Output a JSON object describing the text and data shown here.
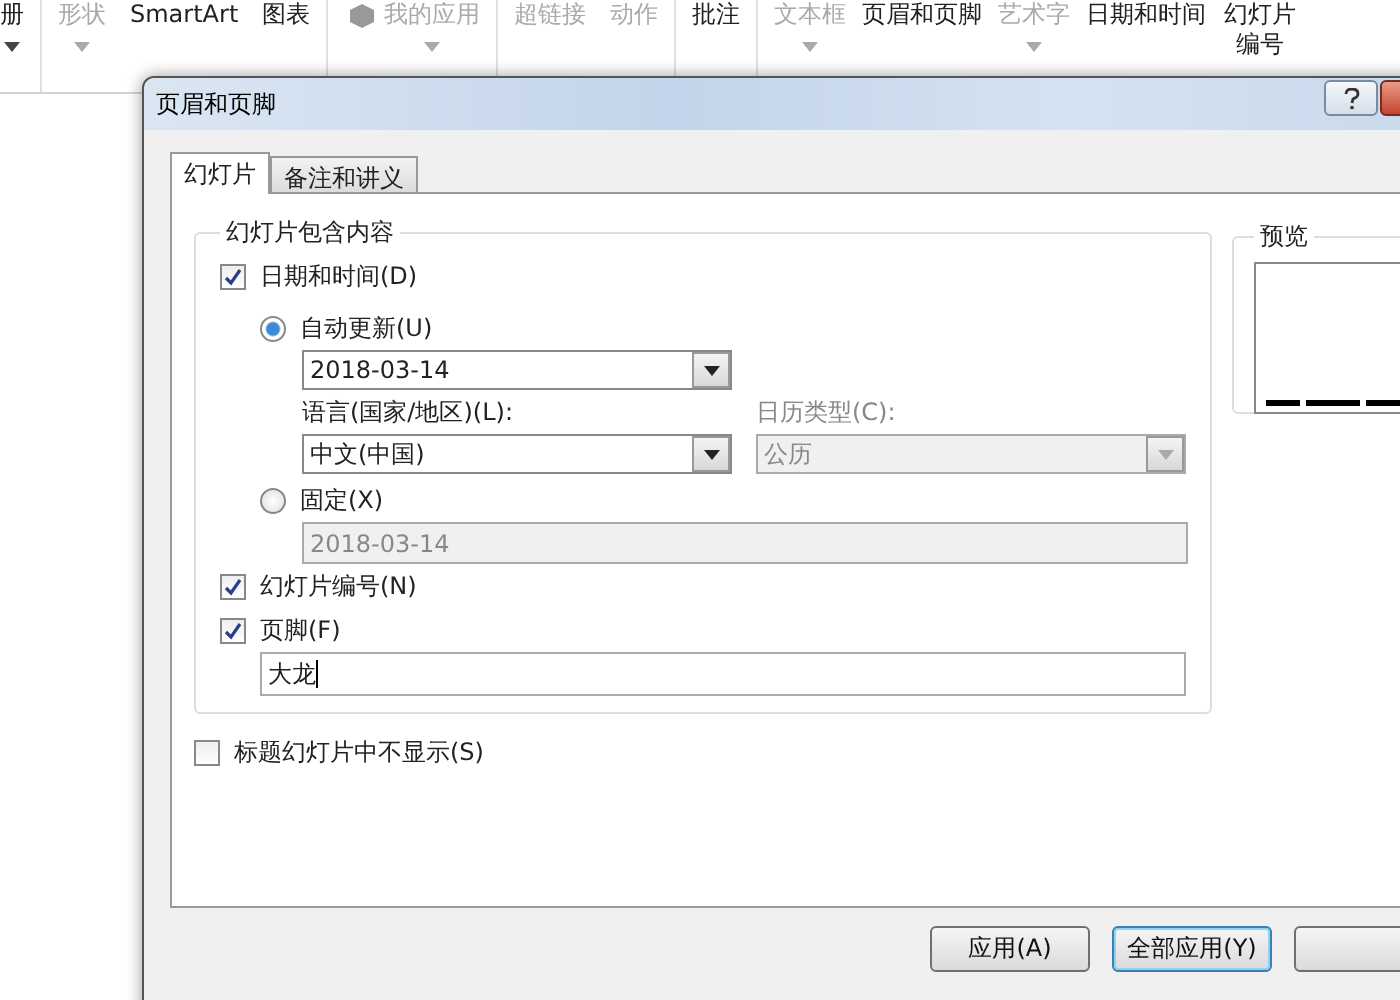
{
  "ribbon": {
    "groups": [
      {
        "items": [
          {
            "label": "册",
            "disabled": false,
            "dropdown": true
          }
        ]
      },
      {
        "items": [
          {
            "label": "形状",
            "disabled": true,
            "dropdown": true
          },
          {
            "label": "SmartArt",
            "disabled": false,
            "dropdown": false
          },
          {
            "label": "图表",
            "disabled": false,
            "dropdown": false
          }
        ]
      },
      {
        "items": [
          {
            "label": "我的应用",
            "disabled": true,
            "dropdown": true,
            "icon": true
          }
        ]
      },
      {
        "items": [
          {
            "label": "超链接",
            "disabled": true,
            "dropdown": false
          },
          {
            "label": "动作",
            "disabled": true,
            "dropdown": false
          }
        ]
      },
      {
        "items": [
          {
            "label": "批注",
            "disabled": false,
            "dropdown": false
          }
        ]
      },
      {
        "items": [
          {
            "label": "文本框",
            "disabled": true,
            "dropdown": true
          },
          {
            "label": "页眉和页脚",
            "disabled": false,
            "dropdown": false
          },
          {
            "label": "艺术字",
            "disabled": true,
            "dropdown": true
          },
          {
            "label": "日期和时间",
            "disabled": false,
            "dropdown": false
          },
          {
            "label": "幻灯片编号",
            "disabled": false,
            "dropdown": false,
            "wrap": true
          }
        ]
      }
    ]
  },
  "dialog": {
    "title": "页眉和页脚",
    "tabs": [
      {
        "label": "幻灯片",
        "selected": true
      },
      {
        "label": "备注和讲义",
        "selected": false
      }
    ],
    "content_group": {
      "title": "幻灯片包含内容",
      "date_time": {
        "label": "日期和时间(D)",
        "checked": true
      },
      "auto_update": {
        "label": "自动更新(U)",
        "selected": true
      },
      "date_format": {
        "value": "2018-03-14"
      },
      "language": {
        "label": "语言(国家/地区)(L):",
        "value": "中文(中国)"
      },
      "calendar": {
        "label": "日历类型(C):",
        "value": "公历",
        "disabled": true
      },
      "fixed": {
        "label": "固定(X)",
        "selected": false
      },
      "fixed_date": {
        "value": "2018-03-14",
        "disabled": true
      },
      "slide_number": {
        "label": "幻灯片编号(N)",
        "checked": true
      },
      "footer": {
        "label": "页脚(F)",
        "checked": true
      },
      "footer_text": {
        "value": "大龙"
      }
    },
    "hide_on_title": {
      "label": "标题幻灯片中不显示(S)",
      "checked": false
    },
    "preview": {
      "title": "预览"
    },
    "buttons": [
      {
        "label": "应用(A)",
        "default": false
      },
      {
        "label": "全部应用(Y)",
        "default": true
      },
      {
        "default": false
      }
    ]
  }
}
